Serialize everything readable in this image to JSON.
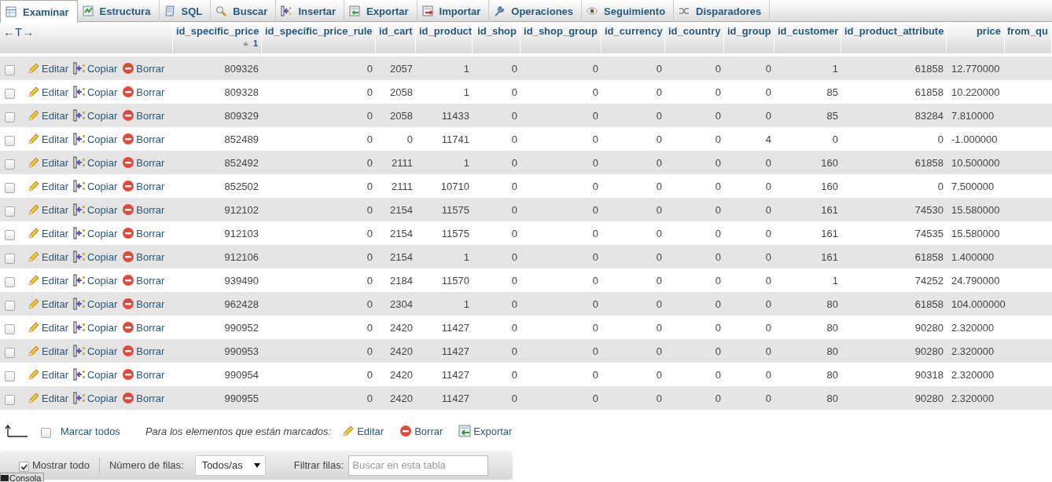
{
  "tabs": [
    {
      "label": "Examinar",
      "kind": "table",
      "selected": true
    },
    {
      "label": "Estructura",
      "kind": "structure",
      "selected": false
    },
    {
      "label": "SQL",
      "kind": "sql",
      "selected": false
    },
    {
      "label": "Buscar",
      "kind": "search",
      "selected": false
    },
    {
      "label": "Insertar",
      "kind": "insert",
      "selected": false
    },
    {
      "label": "Exportar",
      "kind": "export",
      "selected": false
    },
    {
      "label": "Importar",
      "kind": "import",
      "selected": false
    },
    {
      "label": "Operaciones",
      "kind": "wrench",
      "selected": false
    },
    {
      "label": "Seguimiento",
      "kind": "eye",
      "selected": false
    },
    {
      "label": "Disparadores",
      "kind": "triggers",
      "selected": false
    }
  ],
  "table": {
    "column_toggle": "←T→",
    "columns": [
      {
        "name": "id_specific_price",
        "kind": "number",
        "sort_ascending": true,
        "sort_order": "1"
      },
      {
        "name": "id_specific_price_rule",
        "kind": "number"
      },
      {
        "name": "id_cart",
        "kind": "number"
      },
      {
        "name": "id_product",
        "kind": "number"
      },
      {
        "name": "id_shop",
        "kind": "number"
      },
      {
        "name": "id_shop_group",
        "kind": "number"
      },
      {
        "name": "id_currency",
        "kind": "number"
      },
      {
        "name": "id_country",
        "kind": "number"
      },
      {
        "name": "id_group",
        "kind": "number"
      },
      {
        "name": "id_customer",
        "kind": "number"
      },
      {
        "name": "id_product_attribute",
        "kind": "number"
      },
      {
        "name": "price",
        "kind": "decimal"
      },
      {
        "name": "from_qu",
        "kind": "cut"
      }
    ],
    "rows": [
      {
        "checked": false,
        "actions": [
          "Editar",
          "Copiar",
          "Borrar"
        ],
        "cells": [
          "809326",
          "0",
          "2057",
          "1",
          "0",
          "0",
          "0",
          "0",
          "0",
          "1",
          "61858",
          "12.770000"
        ]
      },
      {
        "checked": false,
        "actions": [
          "Editar",
          "Copiar",
          "Borrar"
        ],
        "cells": [
          "809328",
          "0",
          "2058",
          "1",
          "0",
          "0",
          "0",
          "0",
          "0",
          "85",
          "61858",
          "10.220000"
        ]
      },
      {
        "checked": false,
        "actions": [
          "Editar",
          "Copiar",
          "Borrar"
        ],
        "cells": [
          "809329",
          "0",
          "2058",
          "11433",
          "0",
          "0",
          "0",
          "0",
          "0",
          "85",
          "83284",
          "7.810000"
        ]
      },
      {
        "checked": false,
        "actions": [
          "Editar",
          "Copiar",
          "Borrar"
        ],
        "cells": [
          "852489",
          "0",
          "0",
          "11741",
          "0",
          "0",
          "0",
          "0",
          "4",
          "0",
          "0",
          "-1.000000"
        ]
      },
      {
        "checked": false,
        "actions": [
          "Editar",
          "Copiar",
          "Borrar"
        ],
        "cells": [
          "852492",
          "0",
          "2111",
          "1",
          "0",
          "0",
          "0",
          "0",
          "0",
          "160",
          "61858",
          "10.500000"
        ]
      },
      {
        "checked": false,
        "actions": [
          "Editar",
          "Copiar",
          "Borrar"
        ],
        "cells": [
          "852502",
          "0",
          "2111",
          "10710",
          "0",
          "0",
          "0",
          "0",
          "0",
          "160",
          "0",
          "7.500000"
        ]
      },
      {
        "checked": false,
        "actions": [
          "Editar",
          "Copiar",
          "Borrar"
        ],
        "cells": [
          "912102",
          "0",
          "2154",
          "11575",
          "0",
          "0",
          "0",
          "0",
          "0",
          "161",
          "74530",
          "15.580000"
        ]
      },
      {
        "checked": false,
        "actions": [
          "Editar",
          "Copiar",
          "Borrar"
        ],
        "cells": [
          "912103",
          "0",
          "2154",
          "11575",
          "0",
          "0",
          "0",
          "0",
          "0",
          "161",
          "74535",
          "15.580000"
        ]
      },
      {
        "checked": false,
        "actions": [
          "Editar",
          "Copiar",
          "Borrar"
        ],
        "cells": [
          "912106",
          "0",
          "2154",
          "1",
          "0",
          "0",
          "0",
          "0",
          "0",
          "161",
          "61858",
          "1.400000"
        ]
      },
      {
        "checked": false,
        "actions": [
          "Editar",
          "Copiar",
          "Borrar"
        ],
        "cells": [
          "939490",
          "0",
          "2184",
          "11570",
          "0",
          "0",
          "0",
          "0",
          "0",
          "1",
          "74252",
          "24.790000"
        ]
      },
      {
        "checked": false,
        "actions": [
          "Editar",
          "Copiar",
          "Borrar"
        ],
        "cells": [
          "962428",
          "0",
          "2304",
          "1",
          "0",
          "0",
          "0",
          "0",
          "0",
          "80",
          "61858",
          "104.000000"
        ]
      },
      {
        "checked": false,
        "actions": [
          "Editar",
          "Copiar",
          "Borrar"
        ],
        "cells": [
          "990952",
          "0",
          "2420",
          "11427",
          "0",
          "0",
          "0",
          "0",
          "0",
          "80",
          "90280",
          "2.320000"
        ]
      },
      {
        "checked": false,
        "actions": [
          "Editar",
          "Copiar",
          "Borrar"
        ],
        "cells": [
          "990953",
          "0",
          "2420",
          "11427",
          "0",
          "0",
          "0",
          "0",
          "0",
          "80",
          "90280",
          "2.320000"
        ]
      },
      {
        "checked": false,
        "actions": [
          "Editar",
          "Copiar",
          "Borrar"
        ],
        "cells": [
          "990954",
          "0",
          "2420",
          "11427",
          "0",
          "0",
          "0",
          "0",
          "0",
          "80",
          "90318",
          "2.320000"
        ]
      },
      {
        "checked": false,
        "actions": [
          "Editar",
          "Copiar",
          "Borrar"
        ],
        "cells": [
          "990955",
          "0",
          "2420",
          "11427",
          "0",
          "0",
          "0",
          "0",
          "0",
          "80",
          "90280",
          "2.320000"
        ]
      }
    ]
  },
  "bulk_actions": {
    "select_all": {
      "label": "Marcar todos",
      "checked": false
    },
    "prompt": "Para los elementos que están marcados:",
    "buttons": [
      {
        "label": "Editar",
        "kind": "pencil"
      },
      {
        "label": "Borrar",
        "kind": "delete"
      },
      {
        "label": "Exportar",
        "kind": "export"
      }
    ]
  },
  "display_bar": {
    "show_all": {
      "label": "Mostrar todo",
      "checked": true
    },
    "rows_label": "Número de filas:",
    "rows_value": "Todos/as",
    "filter_label": "Filtrar filas:",
    "filter_placeholder": "Buscar en esta tabla"
  },
  "console": {
    "label": "Consola"
  }
}
